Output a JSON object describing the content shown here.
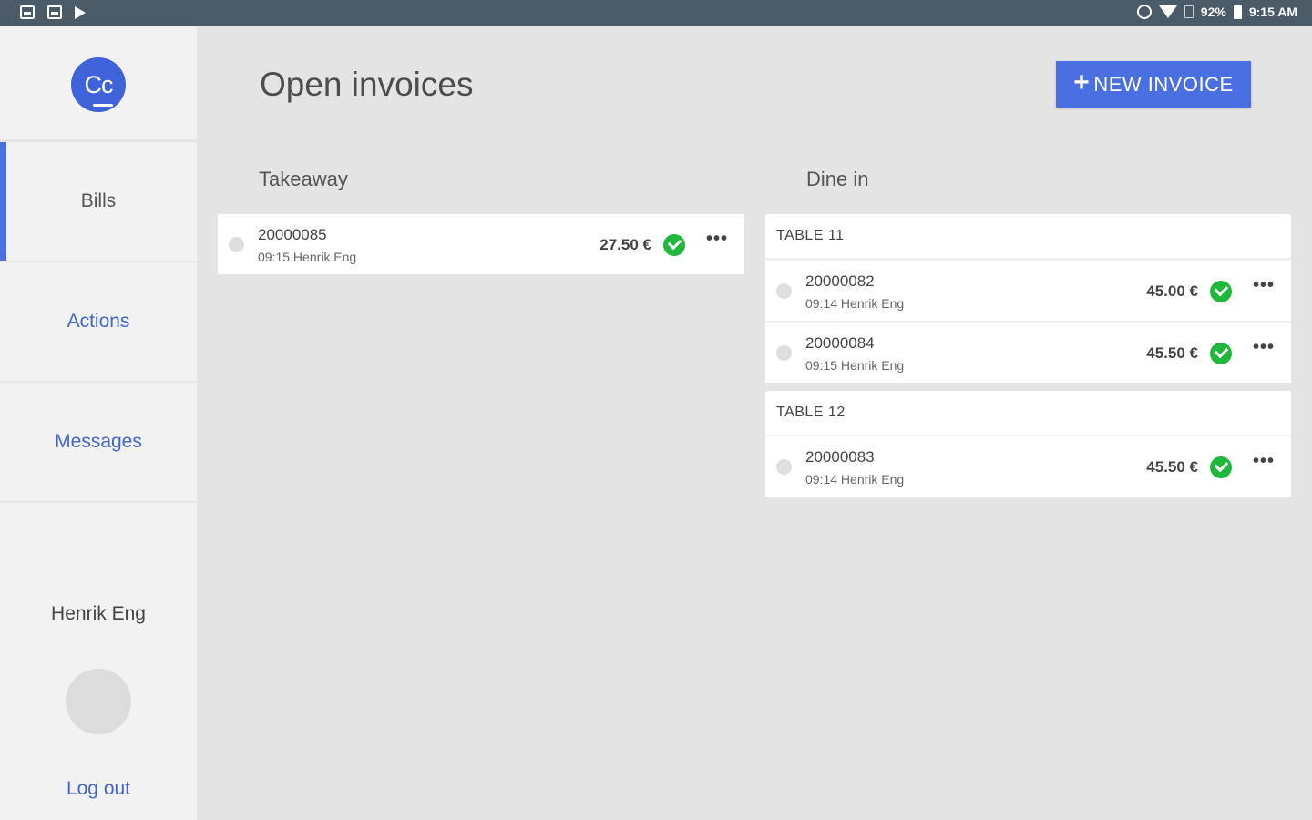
{
  "status_bar": {
    "battery": "92%",
    "time": "9:15 AM"
  },
  "sidebar": {
    "logo_text": "Cc",
    "nav": [
      {
        "label": "Bills"
      },
      {
        "label": "Actions"
      },
      {
        "label": "Messages"
      }
    ],
    "user_name": "Henrik Eng",
    "logout_label": "Log out"
  },
  "header": {
    "title": "Open invoices",
    "new_invoice_label": "NEW INVOICE"
  },
  "takeaway": {
    "title": "Takeaway",
    "invoices": [
      {
        "number": "20000085",
        "meta": "09:15 Henrik Eng",
        "amount": "27.50 €"
      }
    ]
  },
  "dine_in": {
    "title": "Dine in",
    "tables": [
      {
        "name": "TABLE 11",
        "invoices": [
          {
            "number": "20000082",
            "meta": "09:14 Henrik Eng",
            "amount": "45.00 €"
          },
          {
            "number": "20000084",
            "meta": "09:15 Henrik Eng",
            "amount": "45.50 €"
          }
        ]
      },
      {
        "name": "TABLE 12",
        "invoices": [
          {
            "number": "20000083",
            "meta": "09:14 Henrik Eng",
            "amount": "45.50 €"
          }
        ]
      }
    ]
  },
  "colors": {
    "accent": "#4a6fe0",
    "status_bar": "#4a5a66",
    "paid_check": "#1fb83a"
  }
}
